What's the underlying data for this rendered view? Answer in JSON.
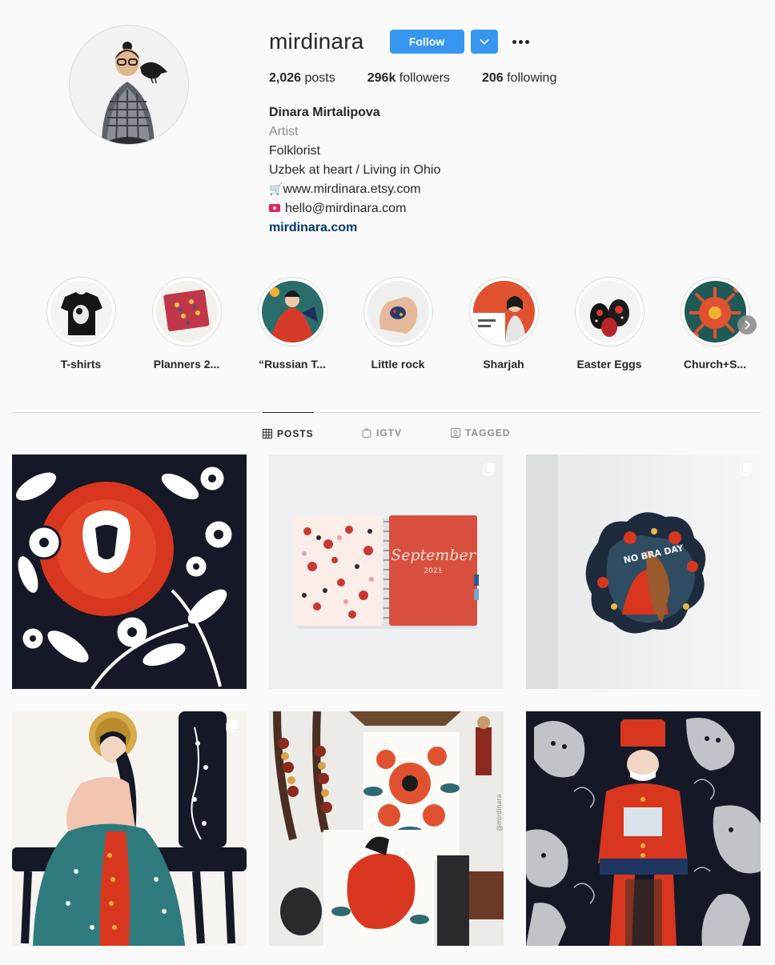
{
  "profile": {
    "username": "mirdinara",
    "follow_label": "Follow",
    "stats": {
      "posts_count": "2,026",
      "posts_label": "posts",
      "followers_count": "296k",
      "followers_label": "followers",
      "following_count": "206",
      "following_label": "following"
    },
    "bio": {
      "full_name": "Dinara Mirtalipova",
      "category": "Artist",
      "line1": "Folklorist",
      "line2": "Uzbek at heart / Living in Ohio",
      "shop": "www.mirdinara.etsy.com",
      "email": "hello@mirdinara.com",
      "link": "mirdinara.com"
    }
  },
  "highlights": [
    {
      "label": "T-shirts",
      "icon": "tshirt-cover"
    },
    {
      "label": "Planners 2...",
      "icon": "planner-cover"
    },
    {
      "label": "“Russian T...",
      "icon": "russian-tales-cover"
    },
    {
      "label": "Little rock",
      "icon": "little-rock-cover"
    },
    {
      "label": "Sharjah",
      "icon": "sharjah-cover"
    },
    {
      "label": "Easter Eggs",
      "icon": "easter-eggs-cover"
    },
    {
      "label": "Church+S...",
      "icon": "church-cover"
    }
  ],
  "tabs": [
    {
      "label": "POSTS",
      "icon": "grid-icon",
      "active": true
    },
    {
      "label": "IGTV",
      "icon": "igtv-icon",
      "active": false
    },
    {
      "label": "TAGGED",
      "icon": "tagged-icon",
      "active": false
    }
  ],
  "posts": [
    {
      "subject": "folk-flower-painting",
      "multiple": false
    },
    {
      "subject": "september-planner",
      "multiple": true,
      "planner_month": "September",
      "planner_year": "2021"
    },
    {
      "subject": "novbraday-sticker",
      "multiple": true,
      "sticker_text": "NO BRA DAY"
    },
    {
      "subject": "folk-woman-painting",
      "multiple": true
    },
    {
      "subject": "studio-shelf-prints",
      "multiple": false,
      "watermark": "@mirdinara"
    },
    {
      "subject": "nutcracker-ghosts-painting",
      "multiple": false
    }
  ],
  "colors": {
    "accent": "#3797f0",
    "link": "#00376b",
    "muted": "#8e8e8e",
    "border": "#dbdbdb"
  }
}
